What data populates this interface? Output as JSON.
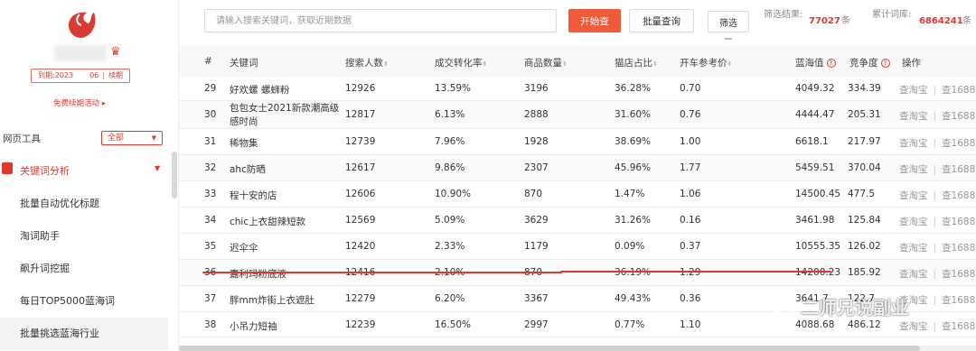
{
  "sidebar": {
    "expire_label": "到期:2023",
    "expire_tail": "06",
    "renew_label": "续期",
    "renew_promo": "免费续期活动 ▸",
    "tools_label": "网页工具",
    "tools_select": "全部",
    "group_label": "关键词分析",
    "items": [
      {
        "label": "批量自动优化标题"
      },
      {
        "label": "淘词助手"
      },
      {
        "label": "飙升词挖掘"
      },
      {
        "label": "每日TOP5000蓝海词"
      },
      {
        "label": "批量挑选蓝海行业"
      }
    ]
  },
  "search": {
    "placeholder": "请输入搜索关键词，获取近期数据",
    "start_label": "开始查",
    "batch_label": "批量查询",
    "filter_label": "筛选"
  },
  "stats": {
    "filtered_label": "筛选结果:",
    "filtered_value": "77027",
    "filtered_unit": "条",
    "total_label": "累计词库:",
    "total_value": "6864241",
    "total_unit": "条"
  },
  "table": {
    "headers": {
      "idx": "#",
      "keyword": "关键词",
      "searchers": "搜索人数",
      "conversion": "成交转化率",
      "products": "商品数量",
      "tmall": "猫店占比",
      "cpc": "开车参考价",
      "blue": "蓝海值",
      "competition": "竞争度",
      "action": "操作"
    },
    "action_taobao": "查淘宝",
    "action_1688": "查1688",
    "rows": [
      {
        "idx": "29",
        "keyword": "好欢螺 螺蛳粉",
        "searchers": "12926",
        "conversion": "13.59%",
        "products": "3196",
        "tmall": "36.28%",
        "cpc": "0.70",
        "blue": "4049.32",
        "competition": "334.39"
      },
      {
        "idx": "30",
        "keyword": "包包女士2021新款潮高级感时尚",
        "searchers": "12817",
        "conversion": "6.13%",
        "products": "2888",
        "tmall": "31.60%",
        "cpc": "0.76",
        "blue": "4444.47",
        "competition": "205.31"
      },
      {
        "idx": "31",
        "keyword": "稀物集",
        "searchers": "12739",
        "conversion": "7.96%",
        "products": "1928",
        "tmall": "38.69%",
        "cpc": "1.00",
        "blue": "6618.1",
        "competition": "217.97"
      },
      {
        "idx": "32",
        "keyword": "ahc防晒",
        "searchers": "12617",
        "conversion": "9.86%",
        "products": "2307",
        "tmall": "45.96%",
        "cpc": "1.77",
        "blue": "5459.51",
        "competition": "370.04"
      },
      {
        "idx": "33",
        "keyword": "程十安的店",
        "searchers": "12606",
        "conversion": "10.90%",
        "products": "870",
        "tmall": "1.47%",
        "cpc": "1.06",
        "blue": "14500.45",
        "competition": "477.5"
      },
      {
        "idx": "34",
        "keyword": "chic上衣甜辣短款",
        "searchers": "12569",
        "conversion": "5.09%",
        "products": "3629",
        "tmall": "31.26%",
        "cpc": "0.16",
        "blue": "3461.98",
        "competition": "125.84"
      },
      {
        "idx": "35",
        "keyword": "迟伞伞",
        "searchers": "12420",
        "conversion": "2.33%",
        "products": "1179",
        "tmall": "0.09%",
        "cpc": "0.37",
        "blue": "10555.35",
        "competition": "126.02"
      },
      {
        "idx": "36",
        "keyword": "嘉利玛粉底液",
        "searchers": "12416",
        "conversion": "2.10%",
        "products": "870",
        "tmall": "36.19%",
        "cpc": "1.29",
        "blue": "14200.23",
        "competition": "185.92"
      },
      {
        "idx": "37",
        "keyword": "胖mm炸街上衣遮肚",
        "searchers": "12279",
        "conversion": "6.20%",
        "products": "3367",
        "tmall": "49.43%",
        "cpc": "0.36",
        "blue": "3641.7",
        "competition": "122.7"
      },
      {
        "idx": "38",
        "keyword": "小吊力短袖",
        "searchers": "12239",
        "conversion": "16.50%",
        "products": "2997",
        "tmall": "0.77%",
        "cpc": "1.10",
        "blue": "4088.68",
        "competition": "486.12"
      }
    ]
  },
  "watermark": {
    "text": "二师兄说副业"
  },
  "colors": {
    "accent": "#e0372f",
    "button": "#ef5a3a"
  }
}
